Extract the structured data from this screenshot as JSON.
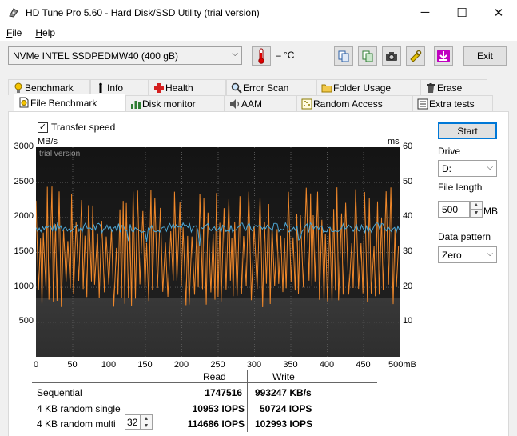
{
  "window": {
    "title": "HD Tune Pro 5.60 - Hard Disk/SSD Utility (trial version)",
    "minimize": "─",
    "maximize": "☐",
    "close": "✕"
  },
  "menu": [
    {
      "accel": "F",
      "rest": "ile"
    },
    {
      "accel": "H",
      "rest": "elp"
    }
  ],
  "toolbar": {
    "drive": "NVMe    INTEL SSDPEDMW40 (400 gB)",
    "temperature": "– °C",
    "exit_label": "Exit"
  },
  "tabs_row1": [
    {
      "label": "Benchmark",
      "icon": "benchmark-icon"
    },
    {
      "label": "Info",
      "icon": "info-icon"
    },
    {
      "label": "Health",
      "icon": "health-icon"
    },
    {
      "label": "Error Scan",
      "icon": "error-scan-icon"
    },
    {
      "label": "Folder Usage",
      "icon": "folder-usage-icon"
    },
    {
      "label": "Erase",
      "icon": "erase-icon"
    }
  ],
  "tabs_row2": [
    {
      "label": "File Benchmark",
      "icon": "file-benchmark-icon",
      "active": true
    },
    {
      "label": "Disk monitor",
      "icon": "disk-monitor-icon"
    },
    {
      "label": "AAM",
      "icon": "aam-icon"
    },
    {
      "label": "Random Access",
      "icon": "random-access-icon"
    },
    {
      "label": "Extra tests",
      "icon": "extra-tests-icon"
    }
  ],
  "transfer_speed_label": "Transfer speed",
  "transfer_speed_checked": true,
  "watermark": "trial version",
  "chart_data": {
    "type": "line",
    "left_unit": "MB/s",
    "right_unit": "ms",
    "x_unit": "mB",
    "xlim": [
      0,
      500
    ],
    "ylim_left": [
      0,
      3000
    ],
    "ylim_right": [
      0,
      60
    ],
    "y_ticks_left": [
      500,
      1000,
      1500,
      2000,
      2500,
      3000
    ],
    "y_ticks_right": [
      10,
      20,
      30,
      40,
      50,
      60
    ],
    "x_ticks": [
      0,
      50,
      100,
      150,
      200,
      250,
      300,
      350,
      400,
      450
    ],
    "x_last_tick": "500mB",
    "series": [
      {
        "color": "#4ea8d6",
        "mean": 1850,
        "spread": 70
      },
      {
        "color": "#f0882a",
        "low": 700,
        "high": 2450
      }
    ]
  },
  "side": {
    "start_label": "Start",
    "drive_label": "Drive",
    "drive_value": "D:",
    "file_length_label": "File length",
    "file_length_value": "500",
    "file_length_unit": "MB",
    "pattern_label": "Data pattern",
    "pattern_value": "Zero"
  },
  "results": {
    "read_header": "Read",
    "write_header": "Write",
    "rows": [
      {
        "label": "Sequential",
        "read": "1747516",
        "write": "993247",
        "unit": "KB/s"
      },
      {
        "label": "4 KB random single",
        "read": "10953",
        "read_unit": "IOPS",
        "write": "50724",
        "unit": "IOPS"
      },
      {
        "label": "4 KB random multi",
        "read": "114686",
        "read_unit": "IOPS",
        "write": "102993",
        "unit": "IOPS"
      }
    ],
    "queue_depth": "32"
  },
  "colors": {
    "graph_bg": "#2e2e2e",
    "graph_top": "#161616",
    "grid": "#555555",
    "read_line": "#4ea8d6",
    "access_line": "#f0882a",
    "accent": "#0078d7"
  }
}
